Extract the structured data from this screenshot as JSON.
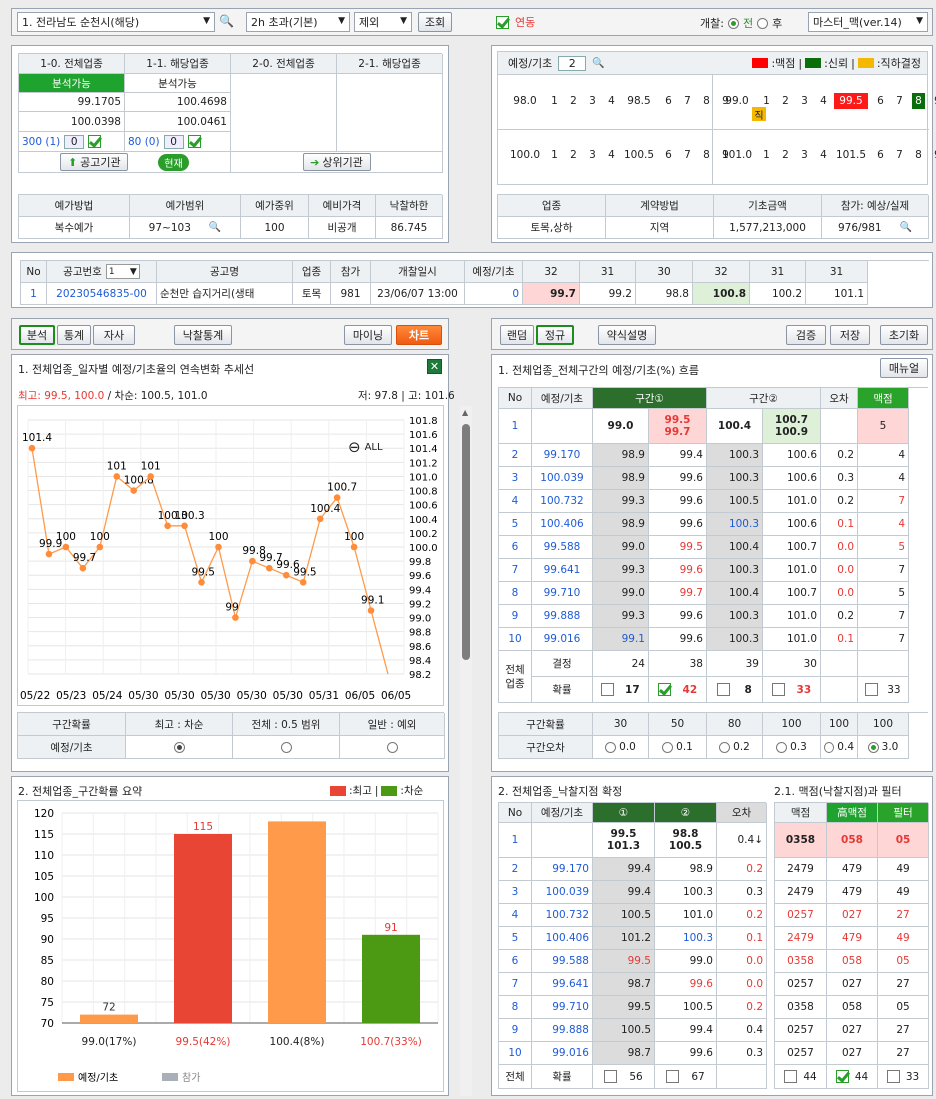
{
  "top": {
    "region": "1. 전라남도 순천시(해당)",
    "time": "2h 초과(기본)",
    "exclude": "제외",
    "search_btn": "조회",
    "link_label": "연동",
    "open_label": "개찰:",
    "open_all": "전",
    "open_after": "후",
    "master": "마스터_맥(ver.14)"
  },
  "p1": {
    "headers": [
      "1-0. 전체업종",
      "1-1. 해당업종",
      "2-0. 전체업종",
      "2-1. 해당업종"
    ],
    "avail": "분석가능",
    "v1a": "99.1705",
    "v1b": "100.4698",
    "v2a": "100.0398",
    "v2b": "100.0461",
    "cnt1": "300 (1)",
    "cnt1v": "0",
    "cnt2": "80 (0)",
    "cnt2v": "0",
    "btn_notice": "공고기관",
    "badge_now": "현재",
    "btn_upper": "상위기관",
    "row_headers": [
      "예가방법",
      "예가범위",
      "예가중위",
      "예비가격",
      "낙찰하한"
    ],
    "row_values": [
      "복수예가",
      "97~103",
      "100",
      "비공개",
      "86.745"
    ]
  },
  "p2": {
    "label": "예정/기초",
    "num": "2",
    "legend": [
      ":맥점",
      ":신뢰",
      ":직하결정"
    ],
    "row1_left": [
      "98.0",
      "1",
      "2",
      "3",
      "4",
      "98.5",
      "6",
      "7",
      "8",
      "9"
    ],
    "row1_right": [
      "99.0",
      "1",
      "2",
      "3",
      "4",
      "99.5",
      "6",
      "7",
      "8",
      "9"
    ],
    "mark_jik": "직",
    "row2_left": [
      "100.0",
      "1",
      "2",
      "3",
      "4",
      "100.5",
      "6",
      "7",
      "8",
      "9"
    ],
    "row2_right": [
      "101.0",
      "1",
      "2",
      "3",
      "4",
      "101.5",
      "6",
      "7",
      "8",
      "9"
    ],
    "row_headers": [
      "업종",
      "계약방법",
      "기초금액",
      "참가: 예상/실제"
    ],
    "row_values": [
      "토목,상하",
      "지역",
      "1,577,213,000",
      "976/981"
    ]
  },
  "list": {
    "headers": [
      "No",
      "공고번호",
      "공고명",
      "업종",
      "참가",
      "개찰일시",
      "예정/기초",
      "32",
      "31",
      "30",
      "32",
      "31",
      "31"
    ],
    "sel": "1",
    "row": [
      "1",
      "20230546835-00",
      "순천만 습지거리(생태",
      "토목",
      "981",
      "23/06/07 13:00",
      "0",
      "99.7",
      "99.2",
      "98.8",
      "100.8",
      "100.2",
      "101.1"
    ]
  },
  "ltabs": {
    "t1": "분석",
    "t2": "통계",
    "t3": "자사",
    "t4": "낙찰통계",
    "t5": "마이닝",
    "t6": "차트"
  },
  "rtabs": {
    "t1": "랜덤",
    "t2": "정규",
    "t3": "약식설명",
    "t4": "검증",
    "t5": "저장",
    "t6": "초기화"
  },
  "chart1": {
    "title": "1. 전체업종_일자별 예정/기초율의 연속변화 추세선",
    "info_red": "최고: 99.5, 100.0",
    "info_black": "/ 차순: 100.5, 101.0",
    "low_high": "저: 97.8 | 고: 101.6",
    "all": "ALL",
    "hdr": [
      "구간확률",
      "최고 : 차순",
      "전체 : 0.5 범위",
      "일반 : 예외"
    ],
    "row_label": "예정/기초"
  },
  "chart_data": [
    {
      "type": "line",
      "title": "1. 전체업종_일자별 예정/기초율의 연속변화 추세선",
      "x": [
        "05/22",
        "05/23",
        "05/24",
        "05/30",
        "05/30",
        "05/30",
        "05/30",
        "05/30",
        "05/31",
        "06/05",
        "06/05"
      ],
      "values": [
        101.4,
        99.9,
        100,
        99.7,
        100,
        101,
        100.8,
        101,
        100.3,
        100.3,
        99.5,
        100,
        99,
        99.8,
        99.7,
        99.6,
        99.5,
        100.4,
        100.7,
        100,
        99.1,
        98.2
      ],
      "labels": [
        "101.4",
        "99.9",
        "100",
        "99.7",
        "100",
        "101",
        "100.8",
        "101",
        "100.3",
        "100.3",
        "99.5",
        "100",
        "99",
        "99.8",
        "99.7",
        "99.6",
        "99.5",
        "100.4",
        "100.7",
        "100",
        "99.1",
        ""
      ],
      "yticks": [
        "101.8",
        "101.6",
        "101.4",
        "101.2",
        "101.0",
        "100.8",
        "100.6",
        "100.4",
        "100.2",
        "100.0",
        "99.8",
        "99.6",
        "99.4",
        "99.2",
        "99.0",
        "98.8",
        "98.6",
        "98.4",
        "98.2"
      ],
      "ylim": [
        98.2,
        101.8
      ]
    },
    {
      "type": "bar",
      "title": "2. 전체업종_구간확률 요약",
      "categories": [
        "99.0(17%)",
        "99.5(42%)",
        "100.4(8%)",
        "100.7(33%)"
      ],
      "values": [
        72,
        115,
        118,
        91
      ],
      "labels": [
        "72",
        "115",
        "",
        "91"
      ],
      "colors": [
        "#ff9a4a",
        "#e84535",
        "#ff9a4a",
        "#4c9a14"
      ],
      "legend": [
        ":최고",
        ":차순"
      ],
      "legend_bottom": [
        "예정/기초",
        "참가"
      ],
      "yticks": [
        "120",
        "115",
        "110",
        "105",
        "100",
        "95",
        "90",
        "85",
        "80",
        "75",
        "70"
      ],
      "ylim": [
        70,
        120
      ]
    }
  ],
  "rt1": {
    "title": "1. 전체업종_전체구간의 예정/기초(%) 흐름",
    "btn": "매뉴얼",
    "h1": [
      "No",
      "예정/기초",
      "구간①",
      "구간②",
      "오차",
      "맥점"
    ],
    "top": [
      "1",
      "",
      "99.0",
      "99.5",
      "99.7",
      "100.4",
      "100.7",
      "100.9",
      "",
      "5"
    ],
    "rows": [
      [
        "2",
        "99.170",
        "98.9",
        "99.4",
        "100.3",
        "100.6",
        "0.2",
        "4"
      ],
      [
        "3",
        "100.039",
        "98.9",
        "99.6",
        "100.3",
        "100.6",
        "0.3",
        "4"
      ],
      [
        "4",
        "100.732",
        "99.3",
        "99.6",
        "100.5",
        "101.0",
        "0.2",
        "7"
      ],
      [
        "5",
        "100.406",
        "98.9",
        "99.6",
        "100.3",
        "100.6",
        "0.1",
        "4"
      ],
      [
        "6",
        "99.588",
        "99.0",
        "99.5",
        "100.4",
        "100.7",
        "0.0",
        "5"
      ],
      [
        "7",
        "99.641",
        "99.3",
        "99.6",
        "100.3",
        "101.0",
        "0.0",
        "7"
      ],
      [
        "8",
        "99.710",
        "99.0",
        "99.7",
        "100.4",
        "100.7",
        "0.0",
        "5"
      ],
      [
        "9",
        "99.888",
        "99.3",
        "99.6",
        "100.3",
        "101.0",
        "0.2",
        "7"
      ],
      [
        "10",
        "99.016",
        "99.1",
        "99.6",
        "100.3",
        "101.0",
        "0.1",
        "7"
      ]
    ],
    "all": "전체",
    "industry": "업종",
    "decide": "결정",
    "d_vals": [
      "24",
      "38",
      "39",
      "30"
    ],
    "prob": "확률",
    "p_vals": [
      "17",
      "42",
      "8",
      "33",
      "33"
    ],
    "hdr2": [
      "구간확률",
      "30",
      "50",
      "80",
      "100",
      "100",
      "100"
    ],
    "err_label": "구간오차",
    "err_vals": [
      "0.0",
      "0.1",
      "0.2",
      "0.3",
      "0.4",
      "3.0"
    ]
  },
  "rt2": {
    "title": "2. 전체업종_낙찰지점 확정",
    "h": [
      "No",
      "예정/기초",
      "①",
      "②",
      "오차"
    ],
    "top": [
      "1",
      "",
      "99.5",
      "101.3",
      "98.8",
      "100.5",
      "0.4↓"
    ],
    "rows": [
      [
        "2",
        "99.170",
        "99.4",
        "98.9",
        "0.2"
      ],
      [
        "3",
        "100.039",
        "99.4",
        "100.3",
        "0.3"
      ],
      [
        "4",
        "100.732",
        "100.5",
        "101.0",
        "0.2"
      ],
      [
        "5",
        "100.406",
        "101.2",
        "100.3",
        "0.1"
      ],
      [
        "6",
        "99.588",
        "99.5",
        "99.0",
        "0.0"
      ],
      [
        "7",
        "99.641",
        "98.7",
        "99.6",
        "0.0"
      ],
      [
        "8",
        "99.710",
        "99.5",
        "100.5",
        "0.2"
      ],
      [
        "9",
        "99.888",
        "100.5",
        "99.4",
        "0.4"
      ],
      [
        "10",
        "99.016",
        "98.7",
        "99.6",
        "0.3"
      ]
    ],
    "all": "전체",
    "prob": "확률",
    "p_vals": [
      "56",
      "67"
    ]
  },
  "rt3": {
    "title": "2.1. 맥점(낙찰지점)과 필터",
    "h": [
      "맥점",
      "高맥점",
      "필터"
    ],
    "top": [
      "0358",
      "058",
      "05"
    ],
    "rows": [
      [
        "2479",
        "479",
        "49"
      ],
      [
        "2479",
        "479",
        "49"
      ],
      [
        "0257",
        "027",
        "27"
      ],
      [
        "2479",
        "479",
        "49"
      ],
      [
        "0358",
        "058",
        "05"
      ],
      [
        "0257",
        "027",
        "27"
      ],
      [
        "0358",
        "058",
        "05"
      ],
      [
        "0257",
        "027",
        "27"
      ],
      [
        "0257",
        "027",
        "27"
      ]
    ],
    "p_vals": [
      "44",
      "44",
      "33"
    ]
  }
}
